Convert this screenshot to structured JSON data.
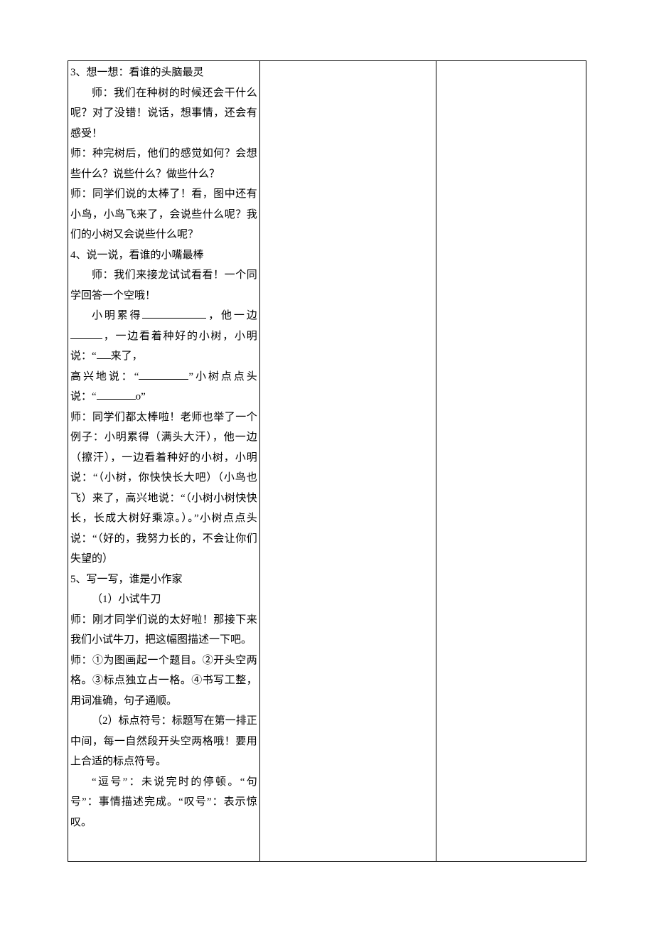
{
  "col1": {
    "s3_title": "3、想一想：看谁的头脑最灵",
    "s3_p1": "师：我们在种树的时候还会干什么呢？对了没错！说话，想事情，还会有感受！",
    "s3_p2": "师：种完树后，他们的感觉如何？会想些什么？说些什么？做些什么？",
    "s3_p3": "师：同学们说的太棒了！看，图中还有小鸟，小鸟飞来了，会说些什么呢？我们的小树又会说些什么呢？",
    "s4_title": "4、说一说，看谁的小嘴最棒",
    "s4_p1": "师：我们来接龙试试看看！一个同学回答一个空哦！",
    "s4_fill_pre": "小明累得",
    "s4_fill_mid1": "，他一边",
    "s4_fill_mid2": "，一边看着种好的小树，小明说：“",
    "s4_fill_mid3": "来了，",
    "s4_fill_line2a": "高兴地说：“",
    "s4_fill_line2b": "”小树点点头说：“",
    "s4_fill_line2c": "o”",
    "s4_p2": "师：同学们都太棒啦！老师也举了一个例子：小明累得（满头大汗），他一边（擦汗），一边看着种好的小树，小明说：“（小树，你快快长大吧）（小鸟也飞）来了，高兴地说：“（小树小树快快长，长成大树好乘凉。）。”小树点点头说：“（好的，我努力长的，不会让你们失望的）",
    "s5_title": "5、写一写，谁是小作家",
    "s5_sub1": "（1）小试牛刀",
    "s5_p1": "师：刚才同学们说的太好啦！那接下来我们小试牛刀，把这幅图描述一下吧。",
    "s5_p2": "师：①为图画起一个题目。②开头空两格。③标点独立占一格。④书写工整，用词准确，句子通顺。",
    "s5_sub2": "（2）标点符号：标题写在第一排正中间，每一自然段开头空两格哦！要用上合适的标点符号。",
    "s5_p3": "“逗号”：未说完时的停顿。“句号”：事情描述完成。“叹号”：表示惊叹。"
  }
}
